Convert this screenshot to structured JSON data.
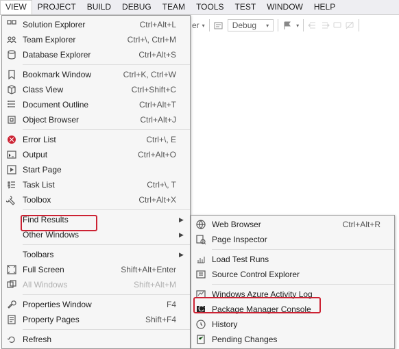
{
  "menubar": [
    "VIEW",
    "PROJECT",
    "BUILD",
    "DEBUG",
    "TEAM",
    "TOOLS",
    "TEST",
    "WINDOW",
    "HELP"
  ],
  "toolbar": {
    "er_suffix": "er",
    "config": "Debug"
  },
  "view_menu": [
    {
      "icon": "solution",
      "label": "Solution Explorer",
      "shortcut": "Ctrl+Alt+L"
    },
    {
      "icon": "team",
      "label": "Team Explorer",
      "shortcut": "Ctrl+\\, Ctrl+M"
    },
    {
      "icon": "db",
      "label": "Database Explorer",
      "shortcut": "Ctrl+Alt+S"
    },
    {
      "sep": true
    },
    {
      "icon": "bookmark",
      "label": "Bookmark Window",
      "shortcut": "Ctrl+K, Ctrl+W"
    },
    {
      "icon": "class",
      "label": "Class View",
      "shortcut": "Ctrl+Shift+C"
    },
    {
      "icon": "outline",
      "label": "Document Outline",
      "shortcut": "Ctrl+Alt+T"
    },
    {
      "icon": "object",
      "label": "Object Browser",
      "shortcut": "Ctrl+Alt+J"
    },
    {
      "sep": true
    },
    {
      "icon": "error",
      "label": "Error List",
      "shortcut": "Ctrl+\\, E"
    },
    {
      "icon": "output",
      "label": "Output",
      "shortcut": "Ctrl+Alt+O"
    },
    {
      "icon": "start",
      "label": "Start Page",
      "shortcut": ""
    },
    {
      "icon": "task",
      "label": "Task List",
      "shortcut": "Ctrl+\\, T"
    },
    {
      "icon": "toolbox",
      "label": "Toolbox",
      "shortcut": "Ctrl+Alt+X"
    },
    {
      "sep": true
    },
    {
      "icon": "",
      "label": "Find Results",
      "shortcut": "",
      "arrow": true
    },
    {
      "icon": "",
      "label": "Other Windows",
      "shortcut": "",
      "arrow": true,
      "highlight": true
    },
    {
      "sep": true
    },
    {
      "icon": "",
      "label": "Toolbars",
      "shortcut": "",
      "arrow": true
    },
    {
      "icon": "fullscreen",
      "label": "Full Screen",
      "shortcut": "Shift+Alt+Enter"
    },
    {
      "icon": "allwin",
      "label": "All Windows",
      "shortcut": "Shift+Alt+M",
      "disabled": true
    },
    {
      "sep": true
    },
    {
      "icon": "props",
      "label": "Properties Window",
      "shortcut": "F4"
    },
    {
      "icon": "proppages",
      "label": "Property Pages",
      "shortcut": "Shift+F4"
    },
    {
      "sep": true
    },
    {
      "icon": "refresh",
      "label": "Refresh",
      "shortcut": ""
    }
  ],
  "submenu": [
    {
      "icon": "web",
      "label": "Web Browser",
      "shortcut": "Ctrl+Alt+R"
    },
    {
      "icon": "pageinsp",
      "label": "Page Inspector",
      "shortcut": ""
    },
    {
      "sep": true
    },
    {
      "icon": "loadtest",
      "label": "Load Test Runs",
      "shortcut": ""
    },
    {
      "icon": "scc",
      "label": "Source Control Explorer",
      "shortcut": ""
    },
    {
      "sep": true
    },
    {
      "icon": "azure",
      "label": "Windows Azure Activity Log",
      "shortcut": ""
    },
    {
      "icon": "pmc",
      "label": "Package Manager Console",
      "shortcut": "",
      "highlight": true
    },
    {
      "icon": "history",
      "label": "History",
      "shortcut": ""
    },
    {
      "icon": "pending",
      "label": "Pending Changes",
      "shortcut": ""
    }
  ]
}
